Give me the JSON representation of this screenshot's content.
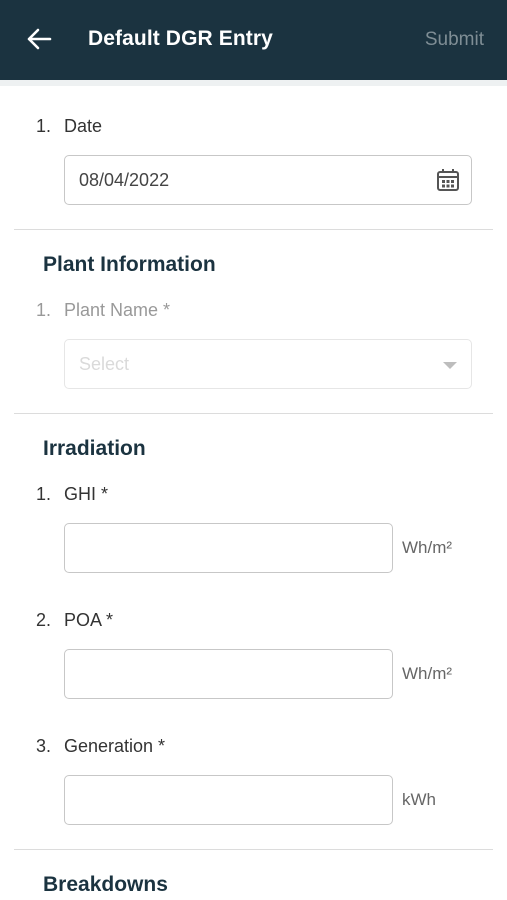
{
  "header": {
    "title": "Default DGR Entry",
    "submit_label": "Submit"
  },
  "date_question": {
    "number": "1.",
    "label": "Date",
    "value": "08/04/2022"
  },
  "plant_section": {
    "title": "Plant Information",
    "question": {
      "number": "1.",
      "label": "Plant Name *",
      "placeholder": "Select"
    }
  },
  "irradiation_section": {
    "title": "Irradiation",
    "questions": [
      {
        "number": "1.",
        "label": "GHI *",
        "unit": "Wh/m²"
      },
      {
        "number": "2.",
        "label": "POA *",
        "unit": "Wh/m²"
      },
      {
        "number": "3.",
        "label": "Generation *",
        "unit": "kWh"
      }
    ]
  },
  "breakdowns_section": {
    "title": "Breakdowns"
  },
  "colors": {
    "appbar": "#1b3340",
    "submit_disabled": "#7f8e95"
  }
}
